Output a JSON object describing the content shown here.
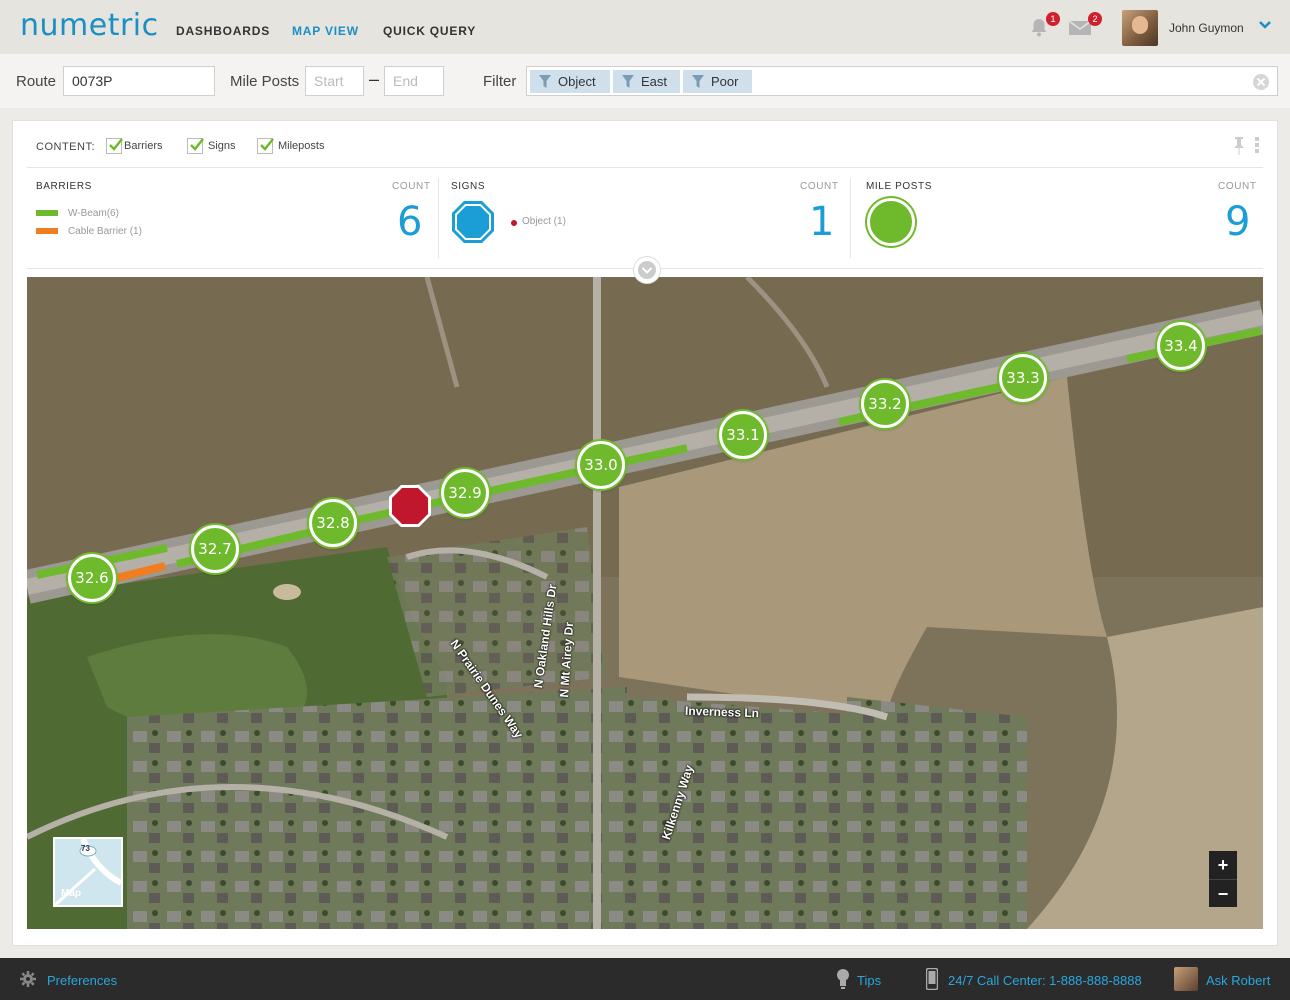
{
  "app": {
    "logo": "numetric"
  },
  "nav": {
    "dashboards": "DASHBOARDS",
    "map_view": "MAP VIEW",
    "quick_query": "QUICK QUERY"
  },
  "notifications": {
    "alerts_count": "1",
    "messages_count": "2"
  },
  "user": {
    "name": "John Guymon"
  },
  "route_bar": {
    "route_label": "Route",
    "route_value": "0073P",
    "mileposts_label": "Mile Posts",
    "start_placeholder": "Start",
    "end_placeholder": "End",
    "filter_label": "Filter",
    "filters": [
      "Object",
      "East",
      "Poor"
    ]
  },
  "content": {
    "label": "CONTENT:",
    "toggles": [
      {
        "label": "Barriers",
        "checked": true
      },
      {
        "label": "Signs",
        "checked": true
      },
      {
        "label": "Mileposts",
        "checked": true
      }
    ]
  },
  "summary": {
    "barriers": {
      "title": "BARRIERS",
      "count_label": "COUNT",
      "count": "6",
      "legend": [
        {
          "label": "W-Beam(6)",
          "color": "#6fba2c"
        },
        {
          "label": "Cable Barrier (1)",
          "color": "#f07d1f"
        }
      ]
    },
    "signs": {
      "title": "SIGNS",
      "count_label": "COUNT",
      "count": "1",
      "legend": [
        {
          "label": "Object (1)",
          "color": "#c0172d"
        }
      ],
      "icon_color": "#1b9dd6"
    },
    "mileposts": {
      "title": "MILE  POSTS",
      "count_label": "COUNT",
      "count": "9",
      "icon_color": "#6fba2c"
    }
  },
  "map": {
    "mileposts": [
      "32.6",
      "32.7",
      "32.8",
      "32.9",
      "33.0",
      "33.1",
      "33.2",
      "33.3",
      "33.4"
    ],
    "street_labels": [
      "Inverness Ln",
      "N Mt Airey Dr",
      "N Oakland Hills Dr",
      "N Prairie Dunes Way",
      "Kilkenny Way"
    ],
    "minimap_label": "Map",
    "minimap_route": "73",
    "zoom_in": "+",
    "zoom_out": "−",
    "colors": {
      "wbeam": "#6fba2c",
      "cable": "#f07d1f",
      "sign": "#c0172d"
    }
  },
  "footer": {
    "preferences": "Preferences",
    "tips": "Tips",
    "call_center": "24/7 Call Center: 1-888-888-8888",
    "ask": "Ask Robert"
  }
}
